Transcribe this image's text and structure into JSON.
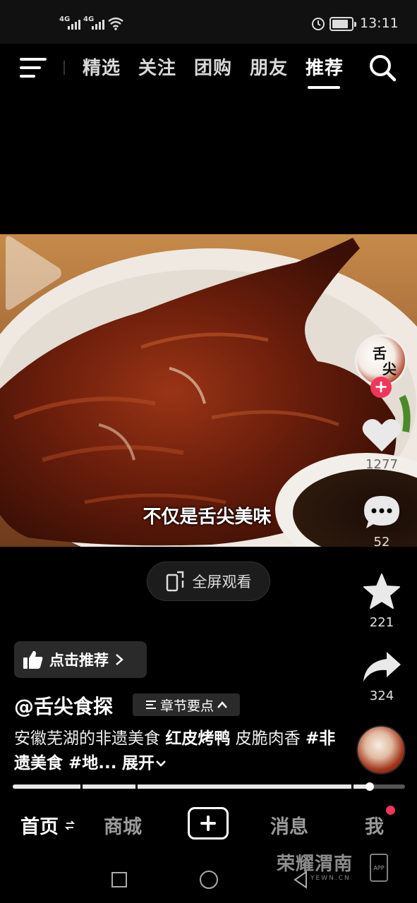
{
  "status_bar": {
    "signal1": "4G",
    "signal2": "4G",
    "time": "13:11"
  },
  "top_nav": {
    "tabs": [
      {
        "label": "精选",
        "active": false
      },
      {
        "label": "关注",
        "active": false
      },
      {
        "label": "团购",
        "active": false
      },
      {
        "label": "朋友",
        "active": false
      },
      {
        "label": "推荐",
        "active": true
      }
    ]
  },
  "video": {
    "subtitle": "不仅是舌尖美味",
    "fullscreen_label": "全屏观看"
  },
  "side_actions": {
    "avatar_glyphs": [
      "舌",
      "尖"
    ],
    "like_count": "1277",
    "comment_count": "52",
    "favorite_count": "221",
    "share_count": "324"
  },
  "post": {
    "recommend_badge": "点击推荐",
    "author": "@舌尖食探",
    "chapter_chip": "章节要点",
    "caption_plain": "安徽芜湖的非遗美食 ",
    "caption_bold": "红皮烤鸭",
    "caption_plain2": " 皮脆肉香 ",
    "caption_tags": "#非遗美食 #地...",
    "expand_label": "展开"
  },
  "progress": {
    "fraction": 0.91
  },
  "bottom_nav": {
    "home": "首页",
    "mall": "商城",
    "messages": "消息",
    "me": "我"
  },
  "watermark": {
    "text": "荣耀渭南",
    "sub": "YEWN.CN",
    "app": "APP"
  },
  "colors": {
    "accent_red": "#f0355a",
    "background": "#000000"
  }
}
